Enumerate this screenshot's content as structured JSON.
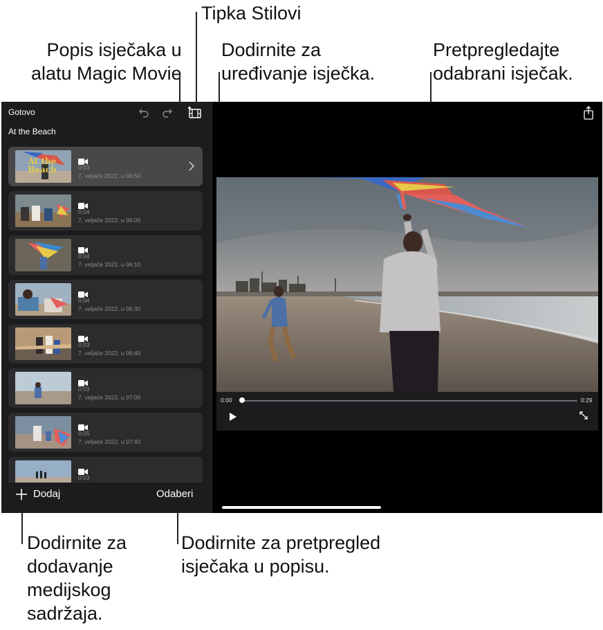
{
  "callouts": {
    "styles_button": "Tipka Stilovi",
    "clip_list": "Popis isječaka u\nalatu Magic Movie",
    "edit_clip": "Dodirnite za\nuređivanje isječka.",
    "preview_clip": "Pretpregledajte\nodabrani isječak.",
    "add_media": "Dodirnite za\ndodavanje\nmedijskog\nsadržaja.",
    "preview_list": "Dodirnite za pretpregled\nisječaka u popisu."
  },
  "app": {
    "done_label": "Gotovo",
    "project_title": "At the Beach",
    "add_label": "Dodaj",
    "select_label": "Odaberi",
    "icons": {
      "undo": "undo-icon",
      "redo": "redo-icon",
      "styles": "styles-icon",
      "share": "share-icon",
      "play": "play-icon",
      "expand": "expand-icon",
      "add": "plus-icon",
      "camera": "video-camera-icon",
      "chevron": "chevron-right-icon"
    }
  },
  "clips": [
    {
      "duration": "0:03",
      "date": "7. veljače 2022. u 06:50",
      "selected": true,
      "thumb_title": "At the Beach",
      "scene": "kite-title"
    },
    {
      "duration": "0:04",
      "date": "7. veljače 2022. u 06:00",
      "selected": false,
      "scene": "family-sitting"
    },
    {
      "duration": "0:04",
      "date": "7. veljače 2022. u 06:10",
      "selected": false,
      "scene": "kite-child"
    },
    {
      "duration": "0:04",
      "date": "7. veljače 2022. u 06:30",
      "selected": false,
      "scene": "beach-closeup"
    },
    {
      "duration": "0:03",
      "date": "7. veljače 2022. u 06:40",
      "selected": false,
      "scene": "sunset-walk"
    },
    {
      "duration": "0:03",
      "date": "7. veljače 2022. u 07:00",
      "selected": false,
      "scene": "child-running"
    },
    {
      "duration": "0:05",
      "date": "7. veljače 2022. u 07:40",
      "selected": false,
      "scene": "kite-run"
    },
    {
      "duration": "0:03",
      "date": "7. veljače 2022. u 07:50",
      "selected": false,
      "scene": "beach-wide"
    }
  ],
  "player": {
    "current_time": "0:00",
    "total_time": "0:29",
    "progress_fraction": 0.0
  },
  "colors": {
    "screen_bg": "#000000",
    "sidebar_bg": "#1c1c1e",
    "clip_bg": "#2c2c2e",
    "clip_selected_bg": "#48484a",
    "secondary_text": "#8e8e93"
  }
}
